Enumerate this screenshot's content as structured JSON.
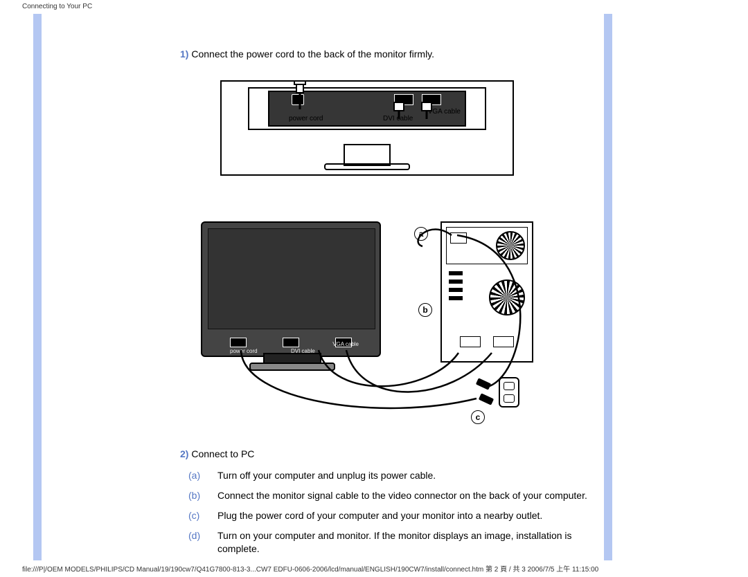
{
  "header": {
    "title": "Connecting to Your PC"
  },
  "steps": {
    "s1": {
      "num": "1)",
      "text": "Connect the power cord to the back of the monitor firmly."
    },
    "s2": {
      "num": "2)",
      "text": "Connect to PC"
    }
  },
  "fig1_labels": {
    "power": "power cord",
    "dvi": "DVI cable",
    "vga": "VGA cable"
  },
  "fig2_labels": {
    "power": "power cord",
    "dvi": "DVI cable",
    "vga": "VGA cable",
    "tag_a": "a",
    "tag_b": "b",
    "tag_c": "c"
  },
  "substeps": [
    {
      "letter": "(a)",
      "text": "Turn off your computer and unplug its power cable."
    },
    {
      "letter": "(b)",
      "text": "Connect the monitor signal cable to the video connector on the back of your computer."
    },
    {
      "letter": "(c)",
      "text": "Plug the power cord of your computer and your monitor into a nearby outlet."
    },
    {
      "letter": "(d)",
      "text": "Turn on your computer and monitor. If the monitor displays an image, installation is complete."
    }
  ],
  "footer": {
    "path": "file:///P|/OEM MODELS/PHILIPS/CD Manual/19/190cw7/Q41G7800-813-3...CW7 EDFU-0606-2006/lcd/manual/ENGLISH/190CW7/install/connect.htm 第 2 頁 / 共 3 2006/7/5 上午 11:15:00"
  }
}
